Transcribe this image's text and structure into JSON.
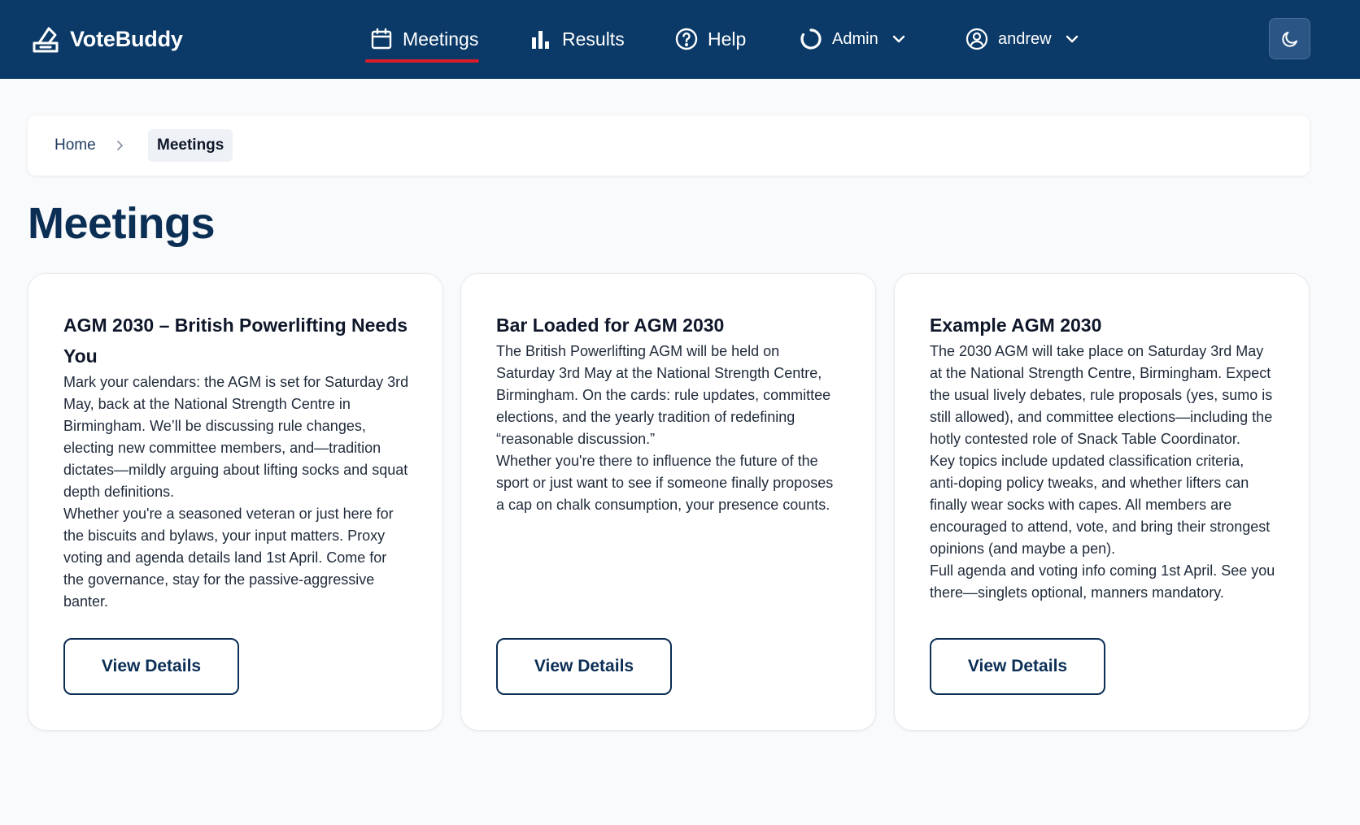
{
  "app": {
    "name": "VoteBuddy"
  },
  "nav": {
    "meetings": "Meetings",
    "results": "Results",
    "help": "Help",
    "admin": "Admin",
    "user": "andrew"
  },
  "breadcrumb": {
    "home": "Home",
    "current": "Meetings"
  },
  "page": {
    "title": "Meetings"
  },
  "cards": [
    {
      "title": "AGM 2030 – British Powerlifting Needs You",
      "paragraphs": [
        "Mark your calendars: the AGM is set for Saturday 3rd May, back at the National Strength Centre in Birmingham. We’ll be discussing rule changes, electing new committee members, and—tradition dictates—mildly arguing about lifting socks and squat depth definitions.",
        "Whether you're a seasoned veteran or just here for the biscuits and bylaws, your input matters. Proxy voting and agenda details land 1st April. Come for the governance, stay for the passive-aggressive banter."
      ],
      "button": "View Details"
    },
    {
      "title": "Bar Loaded for AGM 2030",
      "paragraphs": [
        "The British Powerlifting AGM will be held on Saturday 3rd May at the National Strength Centre, Birmingham. On the cards: rule updates, committee elections, and the yearly tradition of redefining “reasonable discussion.”",
        "Whether you're there to influence the future of the sport or just want to see if someone finally proposes a cap on chalk consumption, your presence counts."
      ],
      "button": "View Details"
    },
    {
      "title": "Example AGM 2030",
      "paragraphs": [
        "The 2030 AGM will take place on Saturday 3rd May at the National Strength Centre, Birmingham. Expect the usual lively debates, rule proposals (yes, sumo is still allowed), and committee elections—including the hotly contested role of Snack Table Coordinator.",
        "Key topics include updated classification criteria, anti-doping policy tweaks, and whether lifters can finally wear socks with capes. All members are encouraged to attend, vote, and bring their strongest opinions (and maybe a pen).",
        "Full agenda and voting info coming 1st April. See you there—singlets optional, manners mandatory."
      ],
      "button": "View Details"
    }
  ],
  "colors": {
    "navbar": "#0b3a68",
    "accent": "#d91e2a",
    "title": "#0b2e55"
  }
}
